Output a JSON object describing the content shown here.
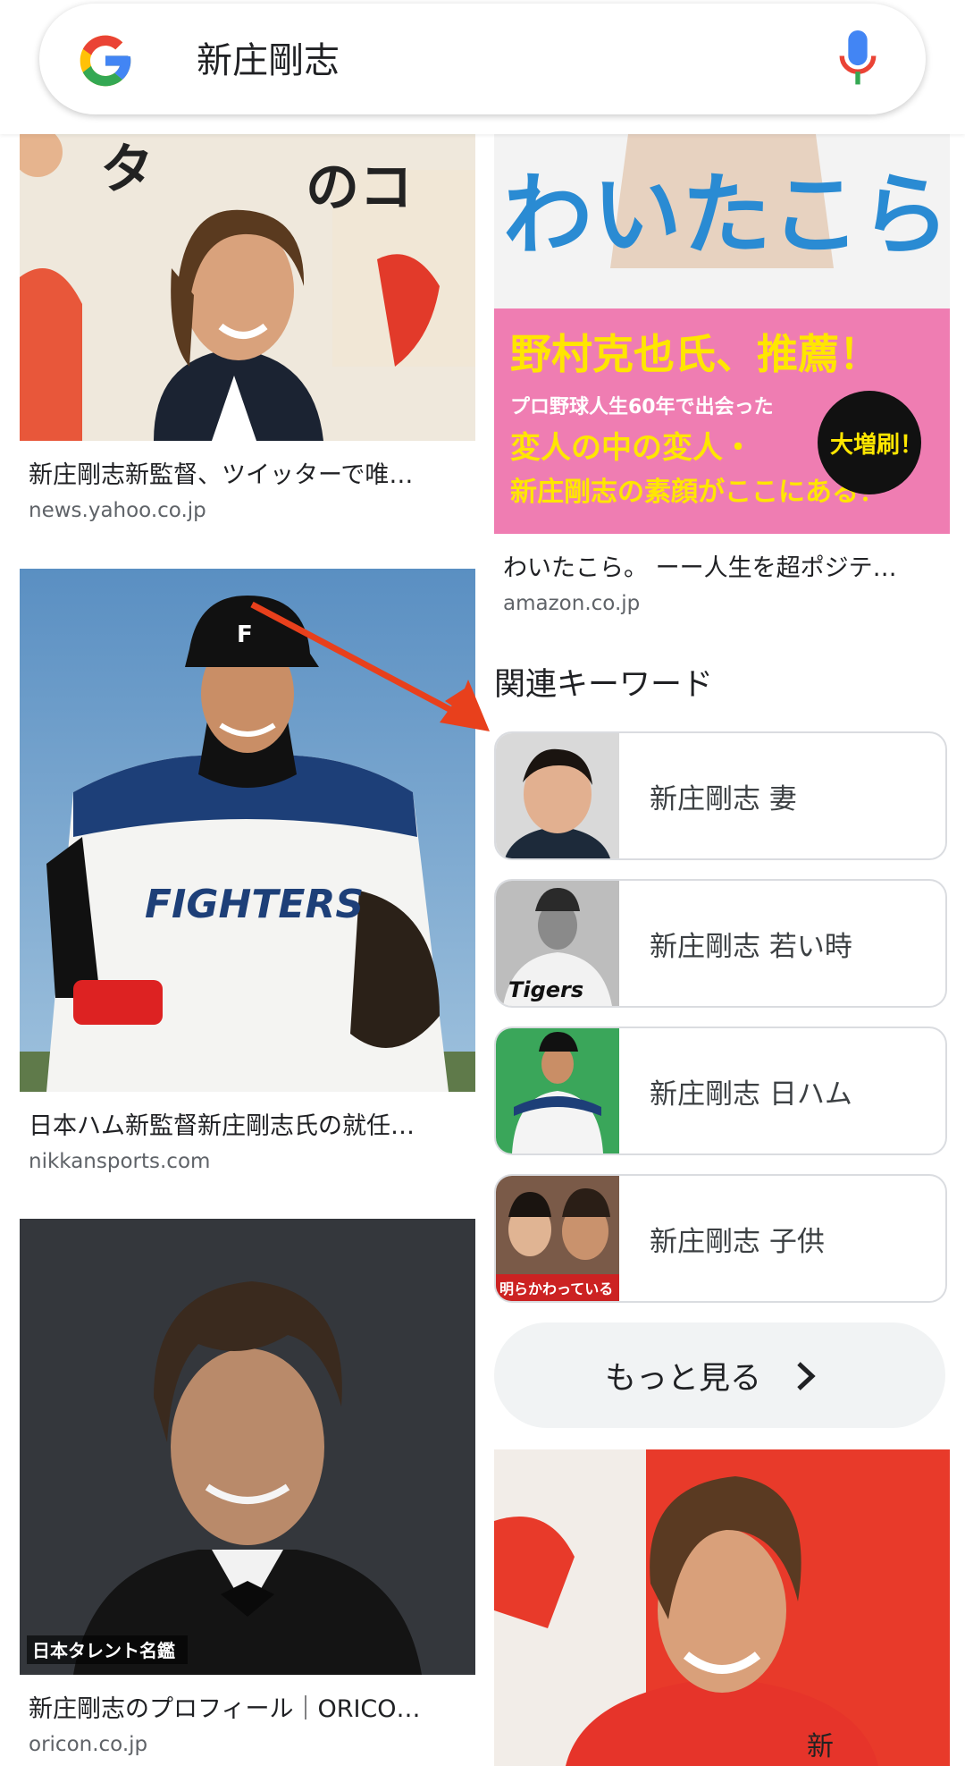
{
  "search": {
    "query": "新庄剛志"
  },
  "colors": {
    "google_blue": "#4285F4",
    "google_red": "#EA4335",
    "google_yellow": "#FBBC05",
    "google_green": "#34A853",
    "arrow": "#E8401C"
  },
  "results_left": [
    {
      "caption": "新庄剛志新監督、ツイッターで唯…",
      "source": "news.yahoo.co.jp",
      "image_text": [
        "タ",
        "のコ"
      ]
    },
    {
      "caption": "日本ハム新監督新庄剛志氏の就任…",
      "source": "nikkansports.com",
      "image_text": [
        "FIGHTERS"
      ]
    },
    {
      "caption": "新庄剛志のプロフィール｜ORICO…",
      "source": "oricon.co.jp",
      "image_text": [
        "日本タレント名鑑"
      ]
    }
  ],
  "results_right": [
    {
      "caption": "わいたこら。 ーー人生を超ポジテ…",
      "source": "amazon.co.jp",
      "image_text": [
        "わいたこら。",
        "野村克也氏、推薦！",
        "プロ野球人生60年で出会った",
        "変人の中の変人・",
        "新庄剛志の素顔がここにある！",
        "大増刷！"
      ]
    },
    {
      "caption": "",
      "source": "",
      "image_text": [
        "新"
      ]
    }
  ],
  "related": {
    "heading": "関連キーワード",
    "items": [
      {
        "label": "新庄剛志 妻"
      },
      {
        "label": "新庄剛志 若い時",
        "image_text": "Tigers"
      },
      {
        "label": "新庄剛志 日ハム"
      },
      {
        "label": "新庄剛志 子供",
        "image_text": "明らかわっている"
      }
    ],
    "more_label": "もっと見る"
  }
}
